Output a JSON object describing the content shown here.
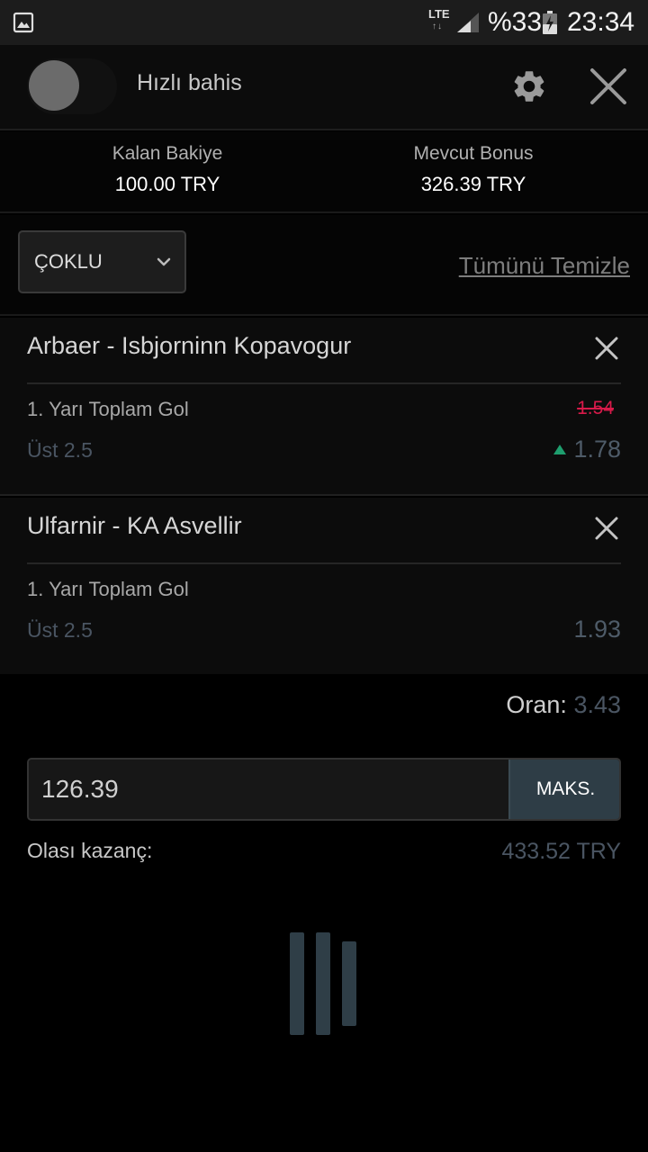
{
  "status_bar": {
    "network": "LTE",
    "battery_pct": "%33",
    "time": "23:34",
    "icons": [
      "gallery-icon",
      "signal-icon",
      "battery-charging-icon"
    ]
  },
  "header": {
    "quick_bet_label": "Hızlı bahis",
    "quick_bet_enabled": false,
    "icons": [
      "gear-icon",
      "close-icon"
    ]
  },
  "balance": {
    "remaining_label": "Kalan Bakiye",
    "remaining_value": "100.00 TRY",
    "bonus_label": "Mevcut Bonus",
    "bonus_value": "326.39 TRY"
  },
  "bet_mode": {
    "selected": "ÇOKLU",
    "clear_all": "Tümünü Temizle"
  },
  "bets": [
    {
      "match": "Arbaer - Isbjorninn Kopavogur",
      "market": "1. Yarı Toplam Gol",
      "selection": "Üst 2.5",
      "old_odd": "1.54",
      "odd": "1.78",
      "odd_trend": "up"
    },
    {
      "match": "Ulfarnir - KA Asvellir",
      "market": "1. Yarı Toplam Gol",
      "selection": "Üst 2.5",
      "odd": "1.93"
    }
  ],
  "summary": {
    "odds_label": "Oran:",
    "odds_value": "3.43",
    "stake_value": "126.39",
    "max_label": "MAKS.",
    "win_label": "Olası kazanç:",
    "win_value": "433.52 TRY"
  },
  "colors": {
    "background": "#000000",
    "card": "#0c0c0c",
    "accent_button": "#2e3d46",
    "old_odd": "#d81a4a",
    "odd_up": "#1e9e6e",
    "muted_value": "#4a5562"
  }
}
